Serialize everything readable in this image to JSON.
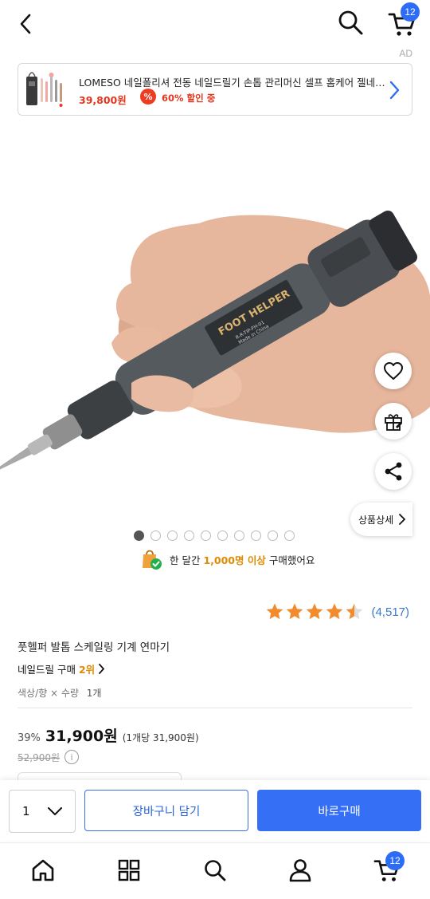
{
  "header": {
    "cart_count": "12"
  },
  "ad": {
    "label": "AD",
    "title": "LOMESO 네일폴리셔 전동 네일드릴기 손톱 관리머신 셀프 홈케어 젤네일드릴,",
    "price": "39,800원",
    "sale_icon": "%",
    "sale_text": "60% 할인 중"
  },
  "gallery": {
    "total_images": 10,
    "active_index": 0,
    "detail_label": "상품상세",
    "image_text": {
      "brand": "FOOT HELPER",
      "model": "R-R-TIP-FH-01",
      "origin": "Made in China"
    }
  },
  "buyers": {
    "prefix": "한 달간",
    "count": "1,000명 이상",
    "suffix": "구매했어요"
  },
  "rating": {
    "stars": 4.5,
    "review_count": "(4,517)"
  },
  "product": {
    "name": "풋헬퍼 발톱 스케일링 기계 연마기",
    "rank_label": "네일드릴 구매",
    "rank_value": "2위",
    "option_label": "색상/향 × 수량",
    "option_value": "1개"
  },
  "pricing": {
    "discount": "39%",
    "price": "31,900원",
    "unit_price": "(1개당 31,900원)",
    "original_price": "52,900원",
    "info_icon": "i"
  },
  "buybar": {
    "quantity": "1",
    "add_to_cart": "장바구니 담기",
    "buy_now": "바로구매"
  },
  "bottom_nav": {
    "items": [
      "home-icon",
      "category-icon",
      "search-icon",
      "user-icon",
      "cart-icon"
    ],
    "cart_count": "12"
  },
  "colors": {
    "accent": "#346ff5",
    "price_red": "#e4361e",
    "highlight_orange": "#e08a00",
    "star": "#f28a2e"
  }
}
